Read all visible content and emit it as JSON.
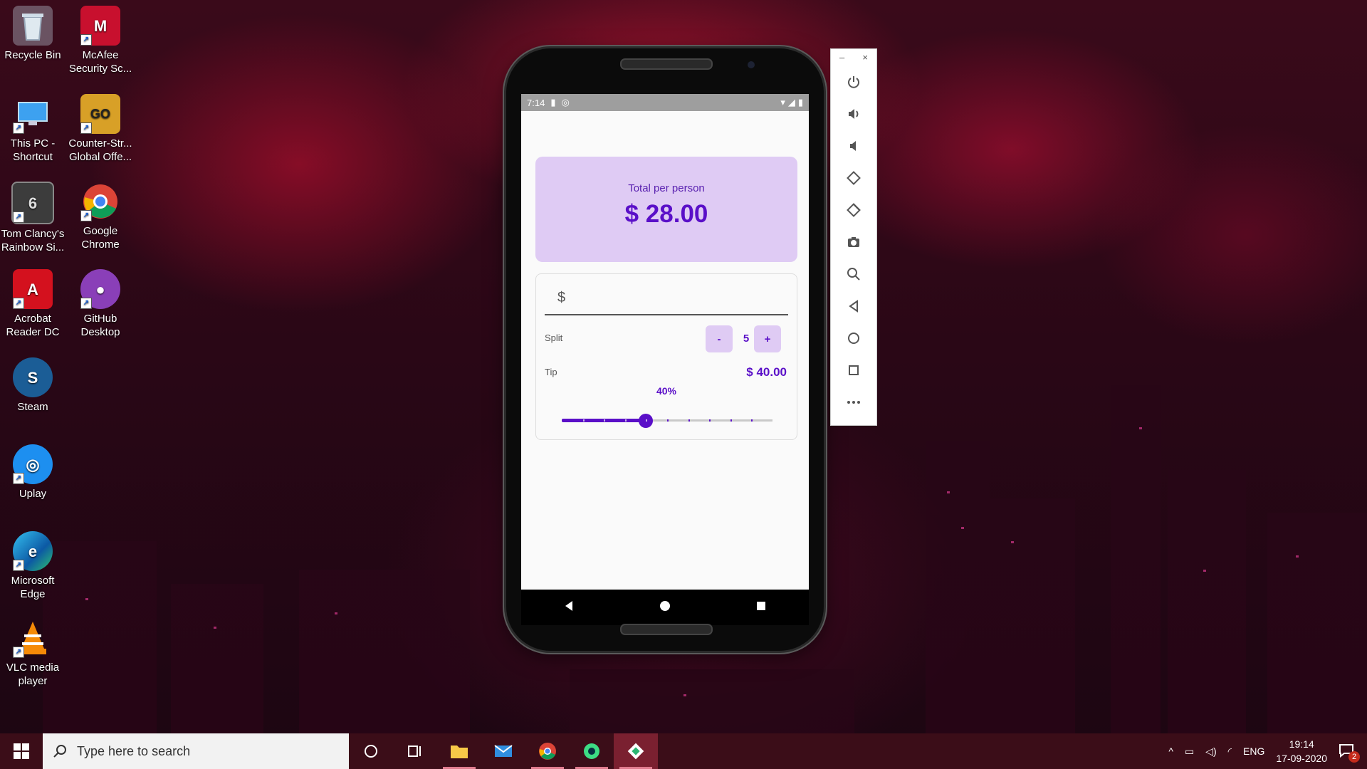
{
  "desktop": {
    "icons": [
      {
        "label": "Recycle Bin"
      },
      {
        "label": "McAfee Security Sc..."
      },
      {
        "label": "This PC - Shortcut"
      },
      {
        "label": "Counter-Str... Global Offe..."
      },
      {
        "label": "Tom Clancy's Rainbow Si..."
      },
      {
        "label": "Google Chrome"
      },
      {
        "label": "Acrobat Reader DC"
      },
      {
        "label": "GitHub Desktop"
      },
      {
        "label": "Steam"
      },
      {
        "label": "Uplay"
      },
      {
        "label": "Microsoft Edge"
      },
      {
        "label": "VLC media player"
      }
    ]
  },
  "phone": {
    "status_time": "7:14",
    "total": {
      "label": "Total per person",
      "amount": "$ 28.00"
    },
    "bill": {
      "prefix": "$",
      "value": ""
    },
    "split": {
      "label": "Split",
      "minus": "-",
      "plus": "+",
      "value": "5"
    },
    "tip": {
      "label": "Tip",
      "amount": "$ 40.00",
      "percent_label": "40%",
      "percent_value": 0.4
    }
  },
  "emulator_panel": {
    "minimize": "–",
    "close": "×",
    "buttons": [
      "power-icon",
      "volume-up-icon",
      "volume-down-icon",
      "rotate-left-icon",
      "rotate-right-icon",
      "camera-icon",
      "zoom-icon",
      "back-icon",
      "home-icon",
      "overview-icon",
      "more-icon"
    ]
  },
  "taskbar": {
    "search_placeholder": "Type here to search",
    "language": "ENG",
    "time": "19:14",
    "date": "17-09-2020",
    "notification_count": "2"
  },
  "colors": {
    "accent": "#5a0fc8",
    "card": "#dfcbf4"
  }
}
